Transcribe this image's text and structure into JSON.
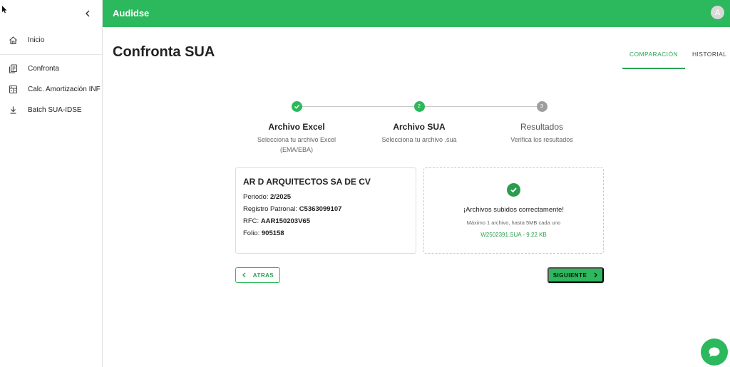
{
  "header": {
    "brand": "Audidse",
    "avatar_initial": "A"
  },
  "sidebar": {
    "items": [
      {
        "label": "Inicio",
        "icon": "home-icon"
      },
      {
        "label": "Confronta",
        "icon": "document-copy-icon"
      },
      {
        "label": "Calc. Amortización INF",
        "icon": "calculator-icon"
      },
      {
        "label": "Batch SUA-IDSE",
        "icon": "download-icon"
      }
    ]
  },
  "page": {
    "title": "Confronta SUA"
  },
  "tabs": [
    {
      "label": "COMPARACIÓN",
      "active": true
    },
    {
      "label": "HISTORIAL",
      "active": false
    }
  ],
  "stepper": {
    "steps": [
      {
        "number": "1",
        "title": "Archivo Excel",
        "subtitle": "Selecciona tu archivo Excel (EMA/EBA)",
        "state": "done"
      },
      {
        "number": "2",
        "title": "Archivo SUA",
        "subtitle": "Selecciona tu archivo .sua",
        "state": "active"
      },
      {
        "number": "3",
        "title": "Resultados",
        "subtitle": "Verifica los resultados",
        "state": "pending"
      }
    ]
  },
  "info": {
    "company": "AR D ARQUITECTOS SA DE CV",
    "periodo_label": "Periodo:",
    "periodo": "2/2025",
    "registro_label": "Registro Patronal:",
    "registro": "C5363099107",
    "rfc_label": "RFC:",
    "rfc": "AAR150203V65",
    "folio_label": "Folio:",
    "folio": "905158"
  },
  "upload": {
    "message": "¡Archivos subidos correctamente!",
    "limit": "Máximo 1 archivo, hasta 5MB cada uno",
    "file": "W2502391.SUA - 9.22 KB"
  },
  "buttons": {
    "back": "ATRAS",
    "next": "SIGUIENTE"
  },
  "colors": {
    "primary": "#2cb85c",
    "primary_dark": "#2a9d4e",
    "pending": "#9e9e9e"
  }
}
